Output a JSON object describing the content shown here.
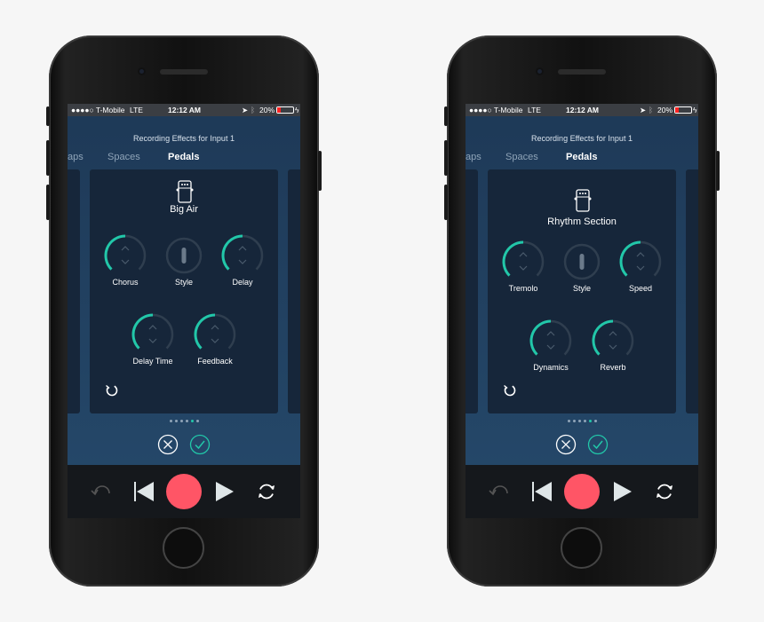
{
  "colors": {
    "accent": "#22c7a9",
    "record": "#ff5566",
    "track": "#2f3e4f"
  },
  "phones": [
    {
      "status": {
        "carrier": "●●●●○ T-Mobile",
        "network": "LTE",
        "time": "12:12 AM",
        "battery": "20%"
      },
      "title": "Recording Effects for Input 1",
      "tabs": [
        {
          "label": "aps"
        },
        {
          "label": "Spaces"
        },
        {
          "label": "Pedals",
          "active": true
        }
      ],
      "pedal_icon": "stompbox-pedal-icon",
      "pedal_name": "Big Air",
      "knobs": [
        {
          "label": "Chorus",
          "type": "dial"
        },
        {
          "label": "Style",
          "type": "switch"
        },
        {
          "label": "Delay",
          "type": "dial"
        },
        {
          "label": "Delay Time",
          "type": "dial"
        },
        {
          "label": "Feedback",
          "type": "dial"
        }
      ],
      "page_count": 6,
      "active_page": 5
    },
    {
      "status": {
        "carrier": "●●●●○ T-Mobile",
        "network": "LTE",
        "time": "12:12 AM",
        "battery": "20%"
      },
      "title": "Recording Effects for Input 1",
      "tabs": [
        {
          "label": "aps"
        },
        {
          "label": "Spaces"
        },
        {
          "label": "Pedals",
          "active": true
        }
      ],
      "pedal_icon": "stompbox-pedal-icon",
      "pedal_name": "Rhythm Section",
      "knobs": [
        {
          "label": "Tremolo",
          "type": "dial"
        },
        {
          "label": "Style",
          "type": "switch"
        },
        {
          "label": "Speed",
          "type": "dial"
        },
        {
          "label": "Dynamics",
          "type": "dial"
        },
        {
          "label": "Reverb",
          "type": "dial"
        }
      ],
      "page_count": 6,
      "active_page": 5
    }
  ]
}
